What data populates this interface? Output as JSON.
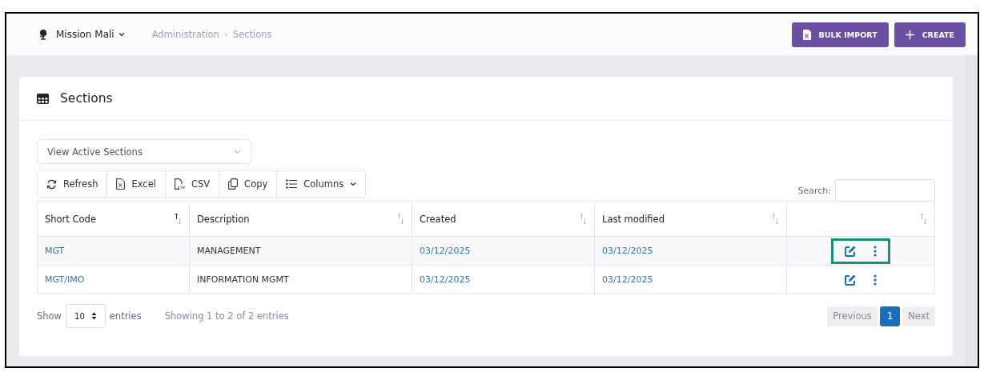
{
  "workspace": {
    "name": "Mission Mali"
  },
  "breadcrumb": [
    "Administration",
    "Sections"
  ],
  "header_buttons": [
    {
      "label": "BULK IMPORT",
      "kind": "import"
    },
    {
      "label": "CREATE",
      "kind": "create"
    }
  ],
  "card": {
    "title": "Sections"
  },
  "filter": {
    "value": "View Active Sections"
  },
  "toolbar": [
    {
      "label": "Refresh",
      "kind": "refresh"
    },
    {
      "label": "Excel",
      "kind": "excel"
    },
    {
      "label": "CSV",
      "kind": "csv"
    },
    {
      "label": "Copy",
      "kind": "copy"
    },
    {
      "label": "Columns",
      "kind": "columns"
    }
  ],
  "search": {
    "label": "Search:"
  },
  "table": {
    "columns": [
      {
        "label": "Short Code",
        "sorted": true
      },
      {
        "label": "Description",
        "sorted": false
      },
      {
        "label": "Created",
        "sorted": false
      },
      {
        "label": "Last modified",
        "sorted": false
      }
    ],
    "rows": [
      {
        "short_code": "MGT",
        "description": "MANAGEMENT",
        "created": "03/12/2025",
        "last_modified": "03/12/2025",
        "highlighted": true
      },
      {
        "short_code": "MGT/IMO",
        "description": "INFORMATION MGMT",
        "created": "03/12/2025",
        "last_modified": "03/12/2025",
        "highlighted": false
      }
    ]
  },
  "footer": {
    "show_label": "Show",
    "page_length": "10",
    "entries_label": "entries",
    "info": "Showing 1 to 2 of 2 entries"
  },
  "pagination": [
    {
      "label": "Previous",
      "kind": "prev",
      "selected": false
    },
    {
      "label": "1",
      "kind": "page",
      "selected": true
    },
    {
      "label": "Next",
      "kind": "next",
      "selected": false
    }
  ]
}
